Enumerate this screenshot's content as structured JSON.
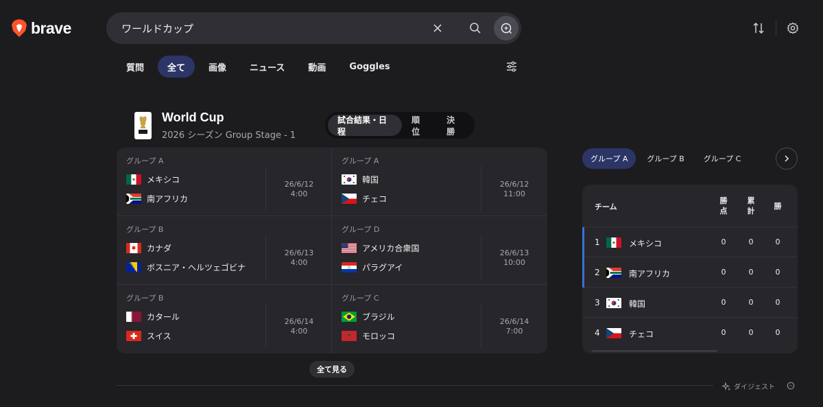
{
  "brand": {
    "name": "brave",
    "accent": "#fb542b"
  },
  "search": {
    "query": "ワールドカップ"
  },
  "tabs": [
    {
      "label": "質問",
      "active": false
    },
    {
      "label": "全て",
      "active": true
    },
    {
      "label": "画像",
      "active": false
    },
    {
      "label": "ニュース",
      "active": false
    },
    {
      "label": "動画",
      "active": false
    },
    {
      "label": "Goggles",
      "active": false
    }
  ],
  "widget": {
    "title": "World Cup",
    "subtitle": "2026 シーズン Group Stage - 1",
    "segments": [
      {
        "label": "試合結果・日程",
        "active": true
      },
      {
        "label": "順位",
        "active": false
      },
      {
        "label": "決勝",
        "active": false
      }
    ],
    "matches": [
      {
        "group": "グループ A",
        "home": {
          "name": "メキシコ",
          "flag": "mexico"
        },
        "away": {
          "name": "南アフリカ",
          "flag": "south-africa"
        },
        "date": "26/6/12",
        "time": "4:00"
      },
      {
        "group": "グループ A",
        "home": {
          "name": "韓国",
          "flag": "korea"
        },
        "away": {
          "name": "チェコ",
          "flag": "czech"
        },
        "date": "26/6/12",
        "time": "11:00"
      },
      {
        "group": "グループ B",
        "home": {
          "name": "カナダ",
          "flag": "canada"
        },
        "away": {
          "name": "ボスニア・ヘルツェゴビナ",
          "flag": "bosnia"
        },
        "date": "26/6/13",
        "time": "4:00"
      },
      {
        "group": "グループ D",
        "home": {
          "name": "アメリカ合衆国",
          "flag": "usa"
        },
        "away": {
          "name": "パラグアイ",
          "flag": "paraguay"
        },
        "date": "26/6/13",
        "time": "10:00"
      },
      {
        "group": "グループ B",
        "home": {
          "name": "カタール",
          "flag": "qatar"
        },
        "away": {
          "name": "スイス",
          "flag": "switzerland"
        },
        "date": "26/6/14",
        "time": "4:00"
      },
      {
        "group": "グループ C",
        "home": {
          "name": "ブラジル",
          "flag": "brazil"
        },
        "away": {
          "name": "モロッコ",
          "flag": "morocco"
        },
        "date": "26/6/14",
        "time": "7:00"
      }
    ],
    "see_all_label": "全て見る"
  },
  "standings": {
    "group_tabs": [
      {
        "label": "グループ A",
        "active": true
      },
      {
        "label": "グループ B",
        "active": false
      },
      {
        "label": "グループ C",
        "active": false
      }
    ],
    "headers": {
      "team": "チーム",
      "points": "勝\n点",
      "total": "累\n計",
      "wins": "勝"
    },
    "rows": [
      {
        "rank": "1",
        "name": "メキシコ",
        "flag": "mexico",
        "points": "0",
        "total": "0",
        "wins": "0",
        "highlight": true
      },
      {
        "rank": "2",
        "name": "南アフリカ",
        "flag": "south-africa",
        "points": "0",
        "total": "0",
        "wins": "0",
        "highlight": true
      },
      {
        "rank": "3",
        "name": "韓国",
        "flag": "korea",
        "points": "0",
        "total": "0",
        "wins": "0",
        "highlight": false
      },
      {
        "rank": "4",
        "name": "チェコ",
        "flag": "czech",
        "points": "0",
        "total": "0",
        "wins": "0",
        "highlight": false
      }
    ]
  },
  "footer": {
    "digest_label": "ダイジェスト"
  }
}
